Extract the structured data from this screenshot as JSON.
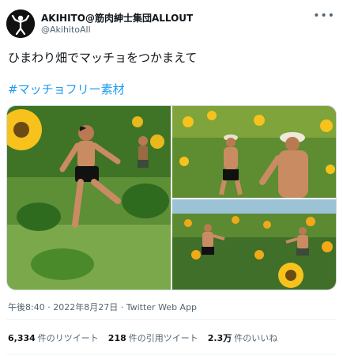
{
  "author": {
    "display_name": "AKIHITO@筋肉紳士集団ALLOUT",
    "handle": "@AkihitoAll",
    "avatar_icon": "flexing-figure-icon"
  },
  "menu_icon": "more-options-icon",
  "tweet": {
    "text": "ひまわり畑でマッチョをつかまえて",
    "hashtag": "#マッチョフリー素材"
  },
  "media": {
    "photo_count": 3
  },
  "meta": {
    "time": "午後8:40",
    "separator": " · ",
    "date": "2022年8月27日",
    "client": "Twitter Web App"
  },
  "stats": {
    "retweets_count": "6,334",
    "retweets_label": "件のリツイート",
    "quotes_count": "218",
    "quotes_label": "件の引用ツイート",
    "likes_count": "2.3万",
    "likes_label": "件のいいね"
  },
  "colors": {
    "link": "#1d9bf0",
    "secondary_text": "#536471",
    "primary_text": "#0f1419",
    "sunflower": "#f6c21b",
    "foliage": "#4f8a2e"
  }
}
